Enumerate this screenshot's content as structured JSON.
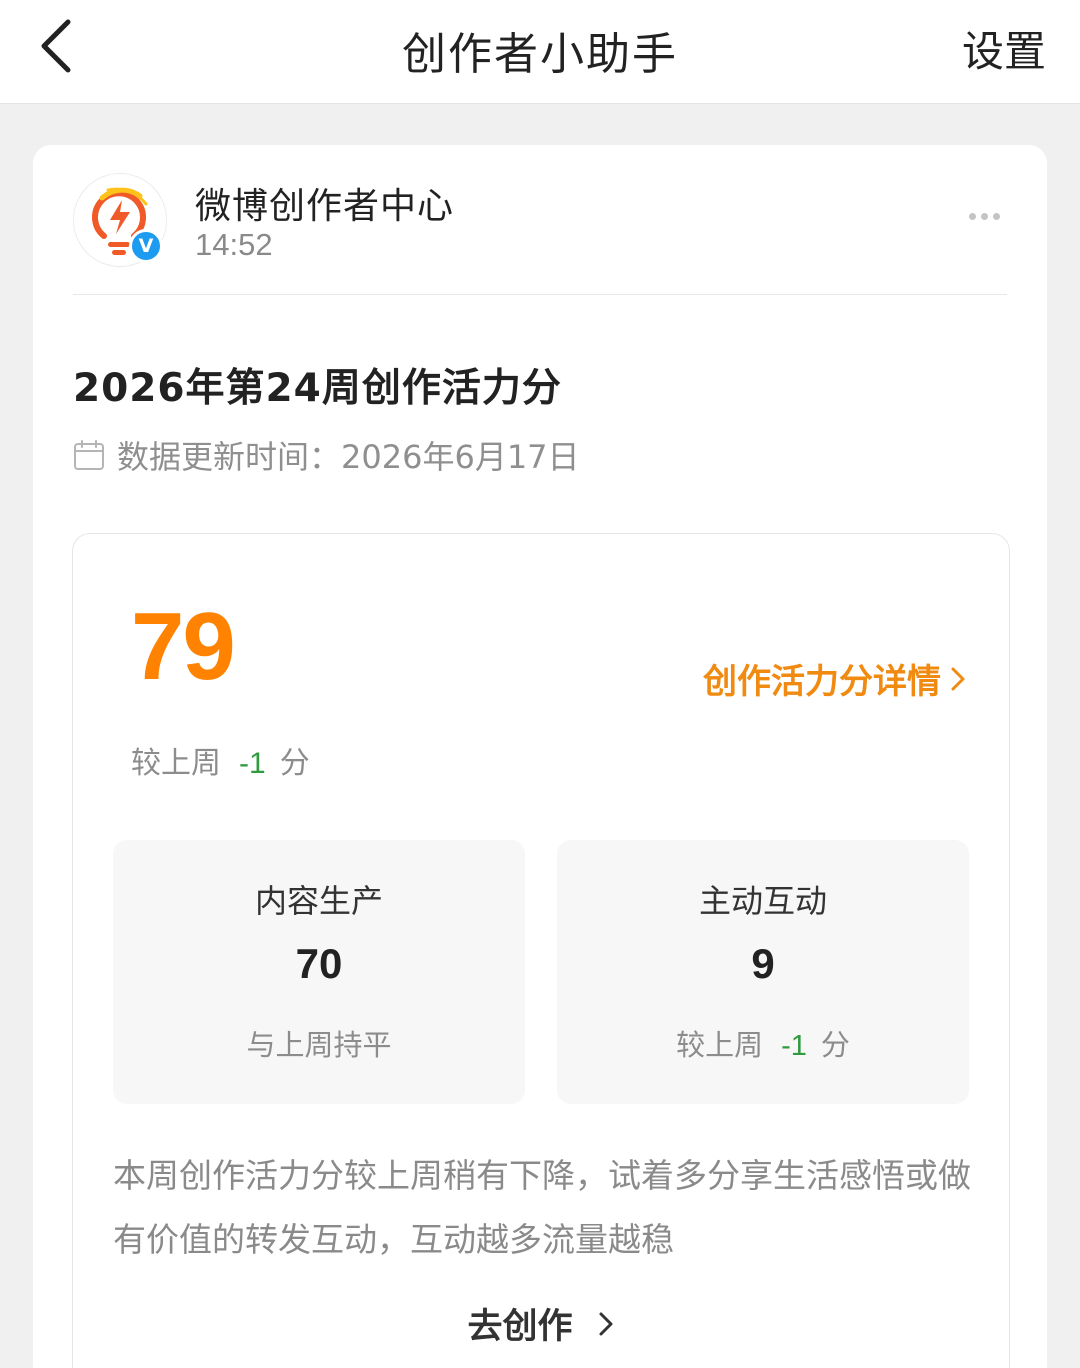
{
  "nav": {
    "title": "创作者小助手",
    "settings": "设置"
  },
  "post": {
    "account_name": "微博创作者中心",
    "time": "14:52",
    "verified_mark": "V",
    "title": "2026年第24周创作活力分",
    "update_label": "数据更新时间：",
    "update_date": "2026年6月17日"
  },
  "score": {
    "total": "79",
    "detail_link": "创作活力分详情",
    "change_prefix": "较上周",
    "change_value": "-1",
    "change_unit": "分",
    "accent_color": "#ff8200"
  },
  "stats": [
    {
      "label": "内容生产",
      "value": "70",
      "sub": "与上周持平"
    },
    {
      "label": "主动互动",
      "value": "9",
      "sub_prefix": "较上周",
      "sub_value": "-1",
      "sub_unit": "分"
    }
  ],
  "tip": "本周创作活力分较上周稍有下降，试着多分享生活感悟或做有价值的转发互动，互动越多流量越稳",
  "cta": "去创作",
  "icons": [
    "back-arrow-icon",
    "more-dots-icon",
    "lightning-bulb-logo-icon",
    "verified-badge-icon",
    "calendar-icon",
    "chevron-right-icon"
  ]
}
